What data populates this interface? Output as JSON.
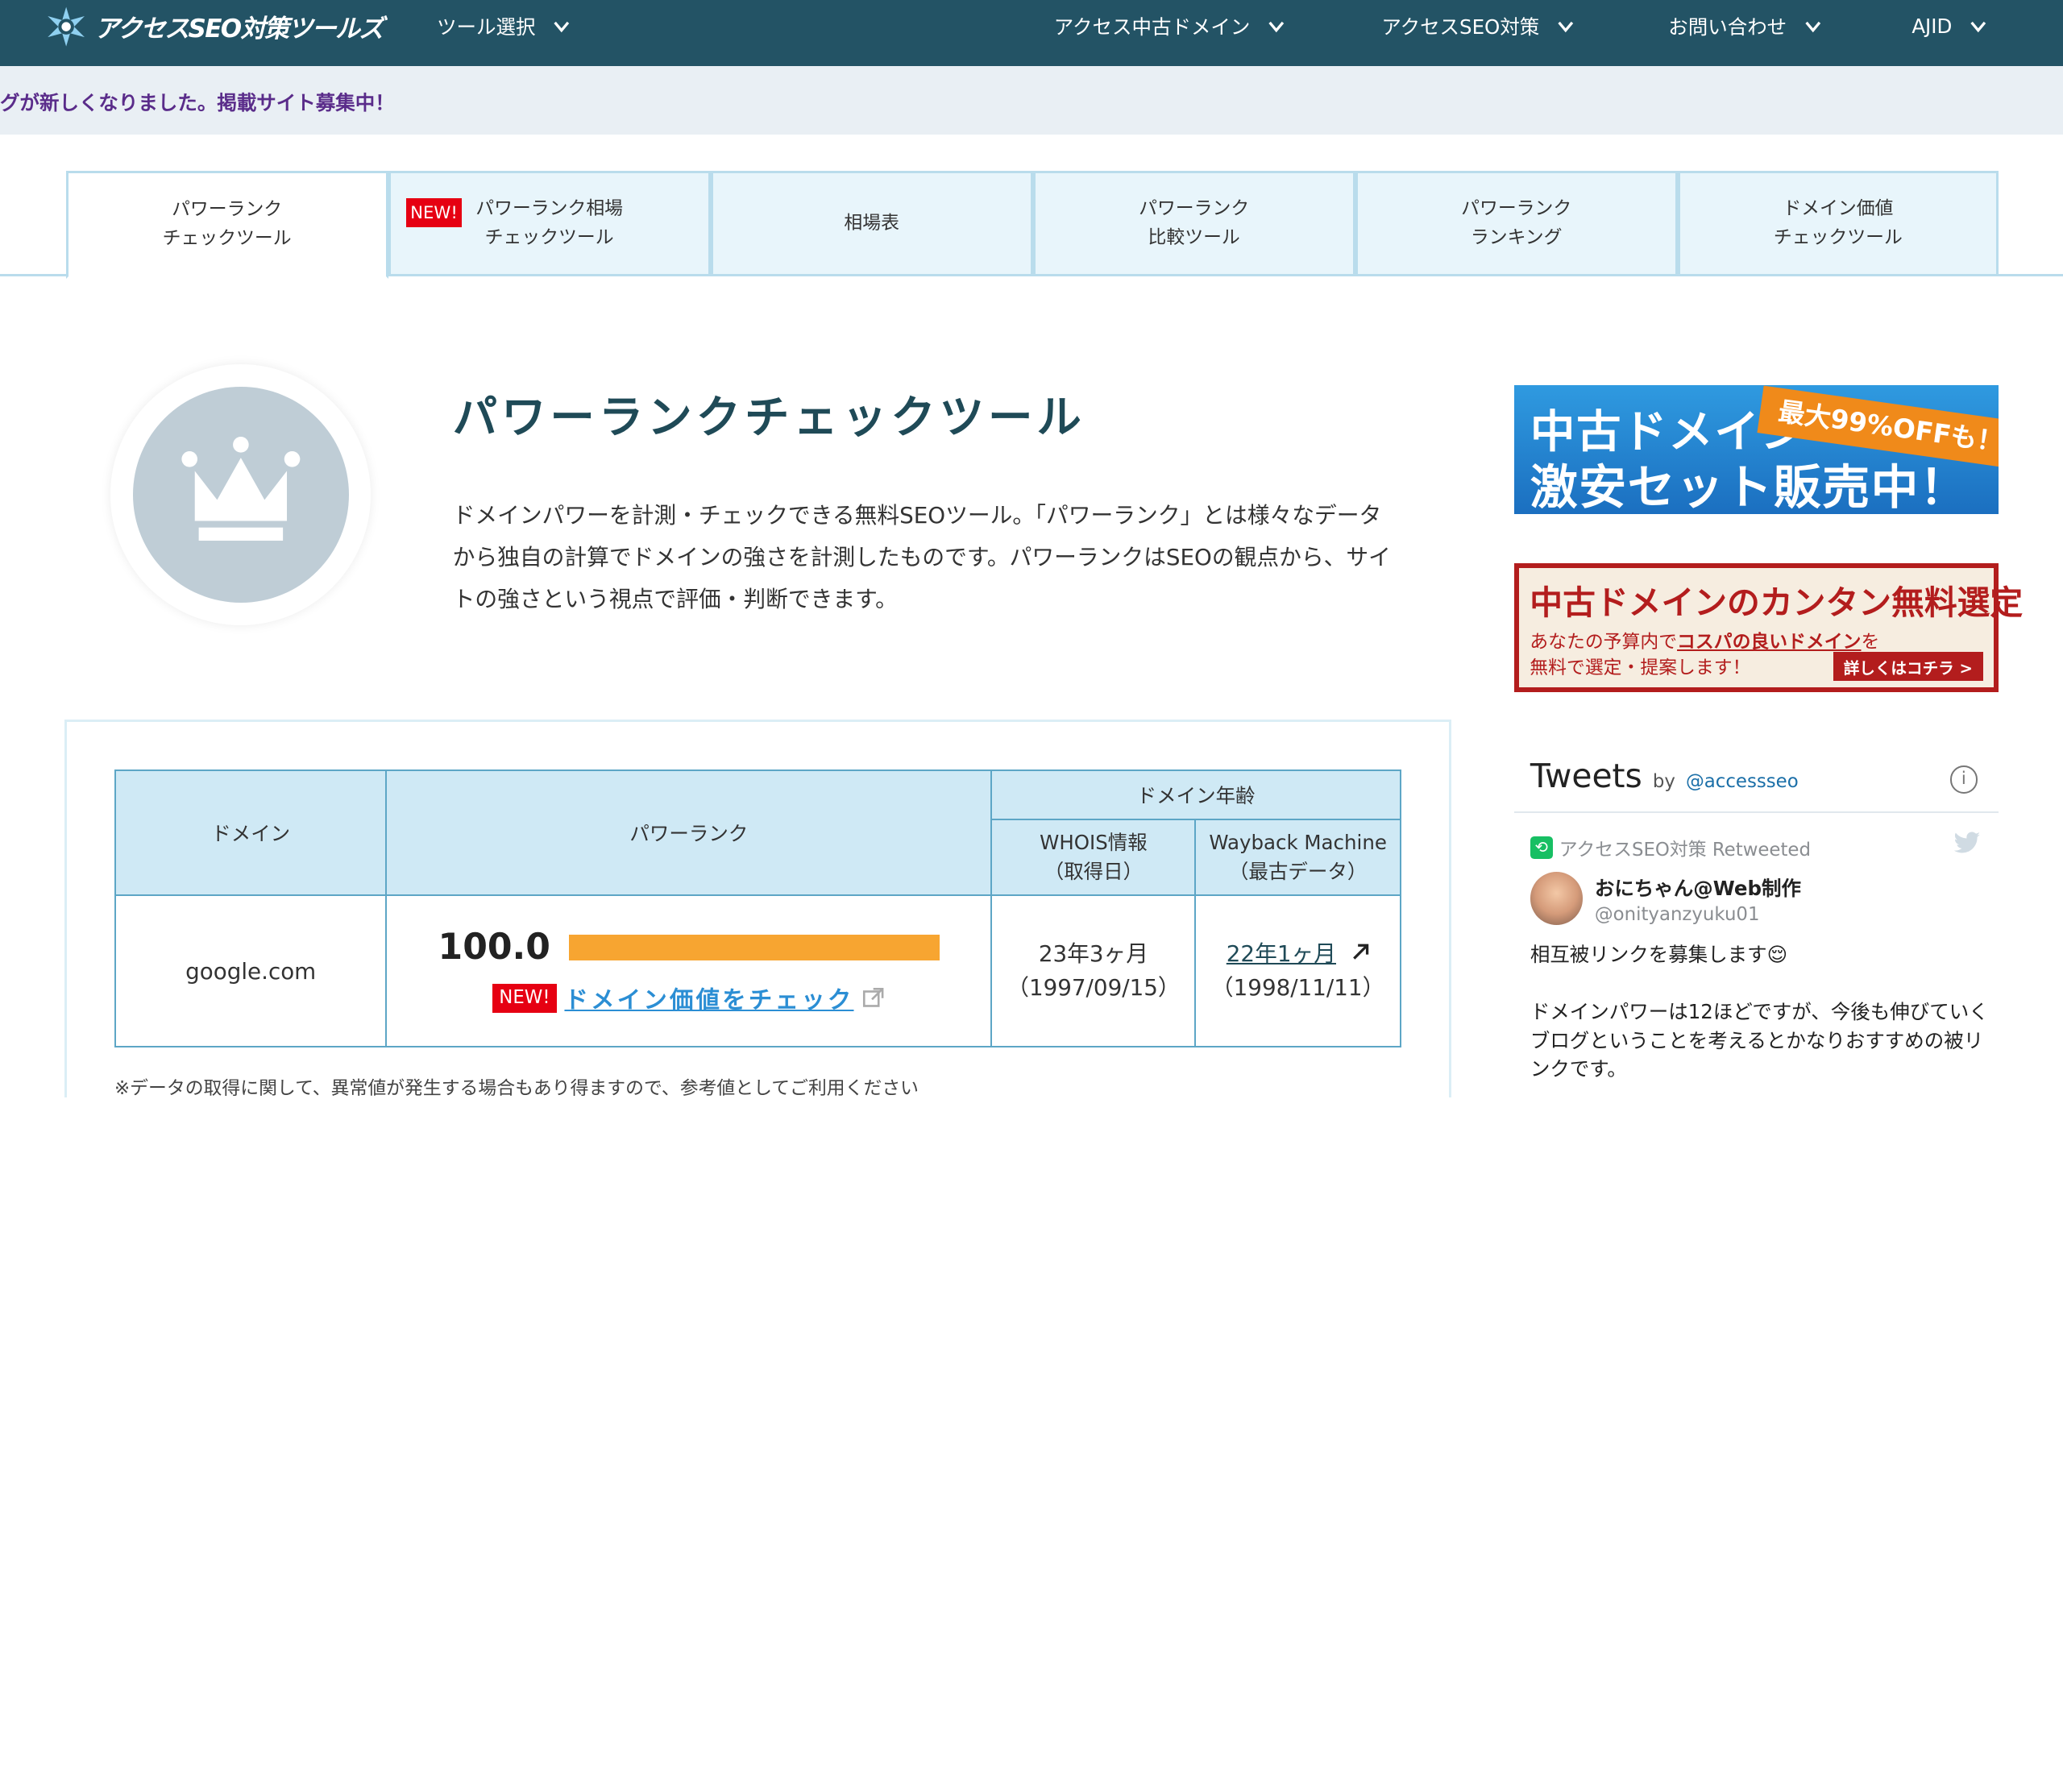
{
  "header": {
    "logo_text": "アクセスSEO対策ツールズ",
    "nav": [
      {
        "label": "ツール選択"
      },
      {
        "label": "アクセス中古ドメイン"
      },
      {
        "label": "アクセスSEO対策"
      },
      {
        "label": "お問い合わせ"
      },
      {
        "label": "AJID"
      }
    ]
  },
  "notice": "グが新しくなりました。掲載サイト募集中！",
  "tabs": [
    {
      "line1": "パワーランク",
      "line2": "チェックツール",
      "active": true
    },
    {
      "badge": "NEW!",
      "line1": "パワーランク相場",
      "line2": "チェックツール"
    },
    {
      "line1": "相場表",
      "line2": ""
    },
    {
      "line1": "パワーランク",
      "line2": "比較ツール"
    },
    {
      "line1": "パワーランク",
      "line2": "ランキング"
    },
    {
      "line1": "ドメイン価値",
      "line2": "チェックツール"
    }
  ],
  "hero": {
    "title": "パワーランクチェックツール",
    "description": "ドメインパワーを計測・チェックできる無料SEOツール。「パワーランク」とは様々なデータから独自の計算でドメインの強さを計測したものです。パワーランクはSEOの観点から、サイトの強さという視点で評価・判断できます。"
  },
  "results": {
    "headers": {
      "domain": "ドメイン",
      "power_rank": "パワーランク",
      "age": "ドメイン年齢",
      "whois": "WHOIS情報",
      "whois_sub": "（取得日）",
      "wayback": "Wayback Machine",
      "wayback_sub": "（最古データ）"
    },
    "row": {
      "domain": "google.com",
      "score": "100.0",
      "score_fraction": 1.0,
      "new_badge": "NEW!",
      "check_link": "ドメイン価値をチェック",
      "whois_age": "23年3ヶ月",
      "whois_date": "（1997/09/15）",
      "wayback_age": "22年1ヶ月",
      "wayback_date": "（1998/11/11）"
    },
    "note": "※データの取得に関して、異常値が発生する場合もあり得ますので、参考値としてご利用ください"
  },
  "ads": {
    "ad1_line1": "中古ドメイン",
    "ad1_line2": "激安セット販売中！",
    "ad1_ribbon": "最大99%OFFも！",
    "ad2_line1": "中古ドメインのカンタン無料選定",
    "ad2_line2_pre": "あなたの予算内で",
    "ad2_line2_em": "コスパの良いドメイン",
    "ad2_line2_post": "を",
    "ad2_line3": "無料で選定・提案します！",
    "ad2_button": "詳しくはコチラ >"
  },
  "twitter": {
    "title": "Tweets",
    "by": "by",
    "handle": "@accessseo",
    "info": "i",
    "retweeted": "アクセスSEO対策 Retweeted",
    "name": "おにちゃん@Web制作",
    "user": "@onityanzyuku01",
    "body1": "相互被リンクを募集します😌",
    "body2": "ドメインパワーは12ほどですが、今後も伸びていくブログということを考えるとかなりおすすめの被リンクです。"
  },
  "colors": {
    "header_bg": "#235365",
    "accent_bar": "#f7a531",
    "link": "#2b8ed4",
    "badge": "#e60012"
  }
}
